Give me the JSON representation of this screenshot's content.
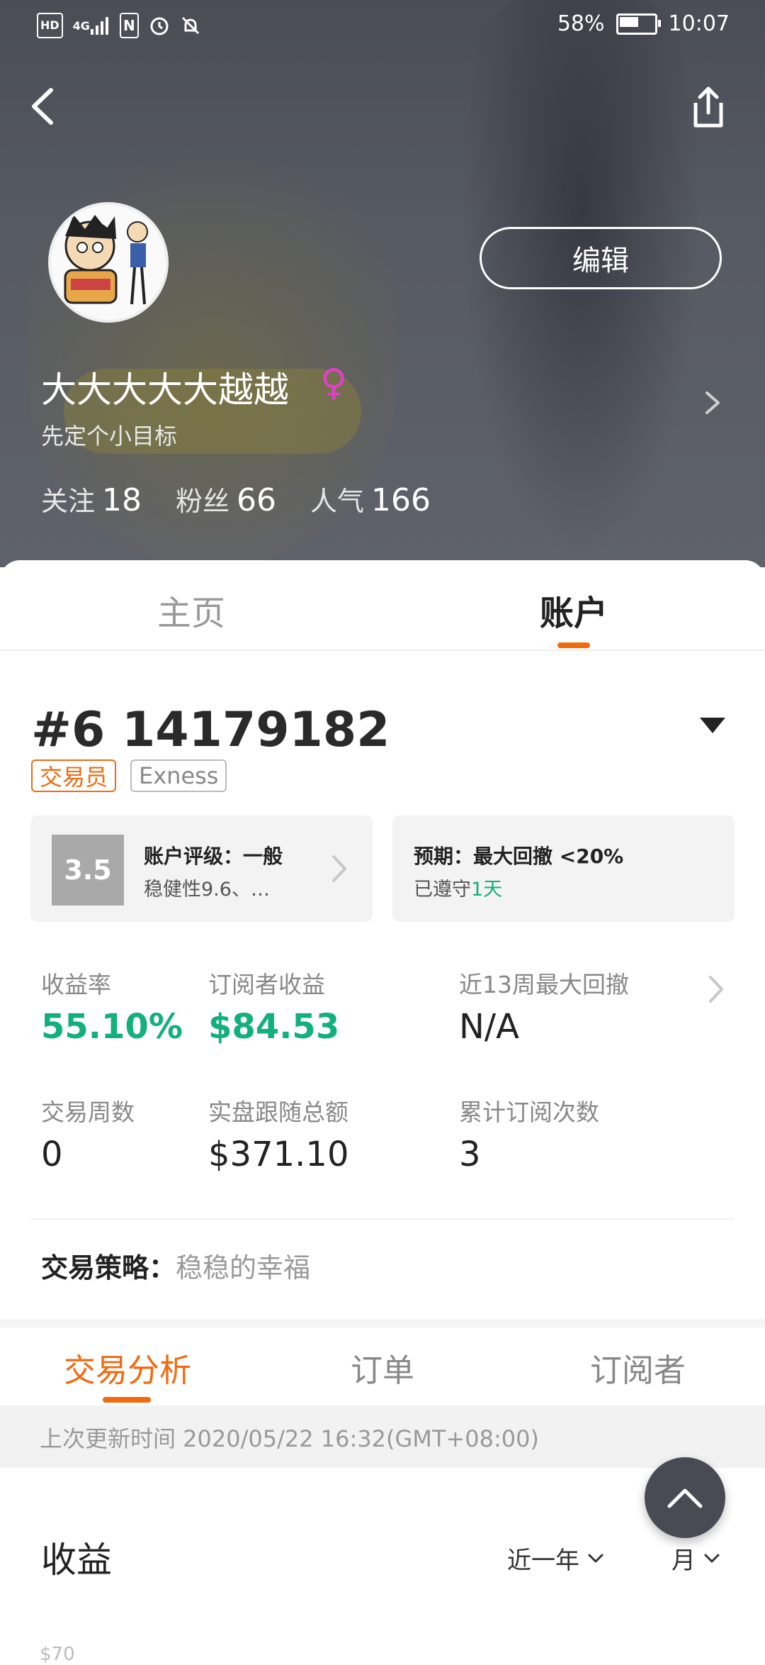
{
  "status_bar": {
    "hd": "HD",
    "network": "4G",
    "nfc": "N",
    "battery_percent": "58%",
    "battery_level": 0.58,
    "time": "10:07"
  },
  "profile": {
    "edit_label": "编辑",
    "username": "大大大大大越越",
    "gender_symbol": "♀",
    "bio": "先定个小目标",
    "following_label": "关注",
    "following_count": "18",
    "followers_label": "粉丝",
    "followers_count": "66",
    "popularity_label": "人气",
    "popularity_count": "166"
  },
  "top_tabs": [
    {
      "label": "主页",
      "active": false
    },
    {
      "label": "账户",
      "active": true
    }
  ],
  "account": {
    "number": "#6 14179182",
    "role_tag": "交易员",
    "broker_tag": "Exness",
    "rating": {
      "score": "3.5",
      "title": "账户评级：一般",
      "subtitle": "稳健性9.6、…"
    },
    "expectation": {
      "title": "预期：最大回撤 <20%",
      "subtitle_prefix": "已遵守",
      "subtitle_value": "1天"
    },
    "metrics": {
      "return_label": "收益率",
      "return_value": "55.10%",
      "sub_profit_label": "订阅者收益",
      "sub_profit_value": "$84.53",
      "max_dd_label": "近13周最大回撤",
      "max_dd_value": "N/A",
      "weeks_label": "交易周数",
      "weeks_value": "0",
      "follow_total_label": "实盘跟随总额",
      "follow_total_value": "$371.10",
      "sub_count_label": "累计订阅次数",
      "sub_count_value": "3"
    },
    "strategy_label": "交易策略：",
    "strategy_value": "稳稳的幸福"
  },
  "sub_tabs": [
    {
      "label": "交易分析",
      "active": true
    },
    {
      "label": "订单",
      "active": false
    },
    {
      "label": "订阅者",
      "active": false
    }
  ],
  "update_text": "上次更新时间 2020/05/22 16:32(GMT+08:00)",
  "earnings": {
    "title": "收益",
    "period": "近一年",
    "granularity": "月",
    "axis_first_label": "$70"
  },
  "colors": {
    "accent": "#f06a0f",
    "positive": "#12b07a",
    "gender": "#e040c8"
  }
}
